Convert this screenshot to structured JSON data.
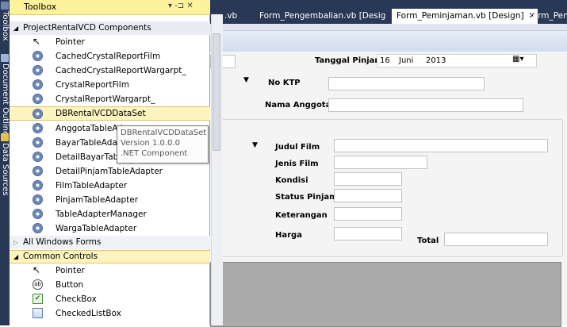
{
  "side_tabs": [
    {
      "label": "Toolbox"
    },
    {
      "label": "Document Outline"
    },
    {
      "label": "Data Sources"
    }
  ],
  "doc_tabs": {
    "partial": ".vb",
    "tab2": "Form_Pengembalian.vb [Design]",
    "active": "Form_Peminjaman.vb [Design]",
    "active_close": "✕",
    "partial_right": "Form_Peng"
  },
  "toolbox": {
    "title": "Toolbox",
    "controls": "▾ ‑⊐ ✕",
    "categories": {
      "project": "ProjectRentalVCD Components",
      "all_windows": "All Windows Forms",
      "common": "Common Controls"
    },
    "project_items": [
      {
        "label": "Pointer",
        "icon": "pointer-icon"
      },
      {
        "label": "CachedCrystalReportFilm",
        "icon": "gear-icon"
      },
      {
        "label": "CachedCrystalReportWargarpt_",
        "icon": "gear-icon"
      },
      {
        "label": "CrystalReportFilm",
        "icon": "gear-icon"
      },
      {
        "label": "CrystalReportWargarpt_",
        "icon": "gear-icon"
      },
      {
        "label": "DBRentalVCDDataSet",
        "icon": "gear-icon"
      },
      {
        "label": "AnggotaTableAdap",
        "icon": "gear-icon"
      },
      {
        "label": "BayarTableAdapter",
        "icon": "gear-icon"
      },
      {
        "label": "DetailBayarTableAc",
        "icon": "gear-icon"
      },
      {
        "label": "DetailPinjamTableAdapter",
        "icon": "gear-icon"
      },
      {
        "label": "FilmTableAdapter",
        "icon": "gear-icon"
      },
      {
        "label": "PinjamTableAdapter",
        "icon": "gear-icon"
      },
      {
        "label": "TableAdapterManager",
        "icon": "gear-icon"
      },
      {
        "label": "WargaTableAdapter",
        "icon": "gear-icon"
      }
    ],
    "common_items": [
      {
        "label": "Pointer",
        "icon": "pointer-icon"
      },
      {
        "label": "Button",
        "icon": "button-icon",
        "glyph": "ab"
      },
      {
        "label": "CheckBox",
        "icon": "checkbox-icon",
        "glyph": "✔"
      },
      {
        "label": "CheckedListBox",
        "icon": "checkedlistbox-icon"
      }
    ]
  },
  "tooltip": {
    "line1": "DBRentalVCDDataSet",
    "line2": "Version 1.0.0.0",
    "line3": ".NET Component"
  },
  "form": {
    "tanggal_label": "Tanggal Pinjam",
    "tanggal_day": "16",
    "tanggal_month": "Juni",
    "tanggal_year": "2013",
    "noktp_label": "No KTP",
    "nama_label": "Nama Anggota",
    "judul_label": "Judul Film",
    "jenis_label": "Jenis Film",
    "kondisi_label": "Kondisi",
    "status_label": "Status Pinjam",
    "keterangan_label": "Keterangan",
    "harga_label": "Harga",
    "total_label": "Total"
  },
  "colors": {
    "chrome": "#293955",
    "title_highlight": "#fff29d",
    "selected_item": "#fdf4bf"
  }
}
